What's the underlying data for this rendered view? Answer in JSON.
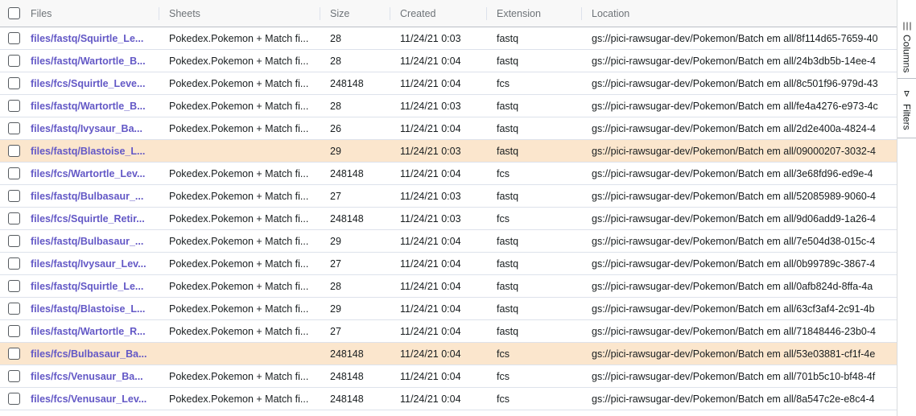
{
  "columns": {
    "files": "Files",
    "sheets": "Sheets",
    "size": "Size",
    "created": "Created",
    "extension": "Extension",
    "location": "Location"
  },
  "side_panel": {
    "columns_label": "Columns",
    "filters_label": "Filters",
    "filter_icon": "⊳"
  },
  "highlight_color": "#fbe6cd",
  "link_color": "#6358c6",
  "rows": [
    {
      "files": "files/fastq/Squirtle_Le...",
      "sheets": "Pokedex.Pokemon + Match fi...",
      "size": "28",
      "created": "11/24/21 0:03",
      "ext": "fastq",
      "loc": "gs://pici-rawsugar-dev/Pokemon/Batch em all/8f114d65-7659-40",
      "highlight": false
    },
    {
      "files": "files/fastq/Wartortle_B...",
      "sheets": "Pokedex.Pokemon + Match fi...",
      "size": "28",
      "created": "11/24/21 0:04",
      "ext": "fastq",
      "loc": "gs://pici-rawsugar-dev/Pokemon/Batch em all/24b3db5b-14ee-4",
      "highlight": false
    },
    {
      "files": "files/fcs/Squirtle_Leve...",
      "sheets": "Pokedex.Pokemon + Match fi...",
      "size": "248148",
      "created": "11/24/21 0:04",
      "ext": "fcs",
      "loc": "gs://pici-rawsugar-dev/Pokemon/Batch em all/8c501f96-979d-43",
      "highlight": false
    },
    {
      "files": "files/fastq/Wartortle_B...",
      "sheets": "Pokedex.Pokemon + Match fi...",
      "size": "28",
      "created": "11/24/21 0:03",
      "ext": "fastq",
      "loc": "gs://pici-rawsugar-dev/Pokemon/Batch em all/fe4a4276-e973-4c",
      "highlight": false
    },
    {
      "files": "files/fastq/Ivysaur_Ba...",
      "sheets": "Pokedex.Pokemon + Match fi...",
      "size": "26",
      "created": "11/24/21 0:04",
      "ext": "fastq",
      "loc": "gs://pici-rawsugar-dev/Pokemon/Batch em all/2d2e400a-4824-4",
      "highlight": false
    },
    {
      "files": "files/fastq/Blastoise_L...",
      "sheets": "",
      "size": "29",
      "created": "11/24/21 0:03",
      "ext": "fastq",
      "loc": "gs://pici-rawsugar-dev/Pokemon/Batch em all/09000207-3032-4",
      "highlight": true
    },
    {
      "files": "files/fcs/Wartortle_Lev...",
      "sheets": "Pokedex.Pokemon + Match fi...",
      "size": "248148",
      "created": "11/24/21 0:04",
      "ext": "fcs",
      "loc": "gs://pici-rawsugar-dev/Pokemon/Batch em all/3e68fd96-ed9e-4",
      "highlight": false
    },
    {
      "files": "files/fastq/Bulbasaur_...",
      "sheets": "Pokedex.Pokemon + Match fi...",
      "size": "27",
      "created": "11/24/21 0:03",
      "ext": "fastq",
      "loc": "gs://pici-rawsugar-dev/Pokemon/Batch em all/52085989-9060-4",
      "highlight": false
    },
    {
      "files": "files/fcs/Squirtle_Retir...",
      "sheets": "Pokedex.Pokemon + Match fi...",
      "size": "248148",
      "created": "11/24/21 0:03",
      "ext": "fcs",
      "loc": "gs://pici-rawsugar-dev/Pokemon/Batch em all/9d06add9-1a26-4",
      "highlight": false
    },
    {
      "files": "files/fastq/Bulbasaur_...",
      "sheets": "Pokedex.Pokemon + Match fi...",
      "size": "29",
      "created": "11/24/21 0:04",
      "ext": "fastq",
      "loc": "gs://pici-rawsugar-dev/Pokemon/Batch em all/7e504d38-015c-4",
      "highlight": false
    },
    {
      "files": "files/fastq/Ivysaur_Lev...",
      "sheets": "Pokedex.Pokemon + Match fi...",
      "size": "27",
      "created": "11/24/21 0:04",
      "ext": "fastq",
      "loc": "gs://pici-rawsugar-dev/Pokemon/Batch em all/0b99789c-3867-4",
      "highlight": false
    },
    {
      "files": "files/fastq/Squirtle_Le...",
      "sheets": "Pokedex.Pokemon + Match fi...",
      "size": "28",
      "created": "11/24/21 0:04",
      "ext": "fastq",
      "loc": "gs://pici-rawsugar-dev/Pokemon/Batch em all/0afb824d-8ffa-4a",
      "highlight": false
    },
    {
      "files": "files/fastq/Blastoise_L...",
      "sheets": "Pokedex.Pokemon + Match fi...",
      "size": "29",
      "created": "11/24/21 0:04",
      "ext": "fastq",
      "loc": "gs://pici-rawsugar-dev/Pokemon/Batch em all/63cf3af4-2c91-4b",
      "highlight": false
    },
    {
      "files": "files/fastq/Wartortle_R...",
      "sheets": "Pokedex.Pokemon + Match fi...",
      "size": "27",
      "created": "11/24/21 0:04",
      "ext": "fastq",
      "loc": "gs://pici-rawsugar-dev/Pokemon/Batch em all/71848446-23b0-4",
      "highlight": false
    },
    {
      "files": "files/fcs/Bulbasaur_Ba...",
      "sheets": "",
      "size": "248148",
      "created": "11/24/21 0:04",
      "ext": "fcs",
      "loc": "gs://pici-rawsugar-dev/Pokemon/Batch em all/53e03881-cf1f-4e",
      "highlight": true
    },
    {
      "files": "files/fcs/Venusaur_Ba...",
      "sheets": "Pokedex.Pokemon + Match fi...",
      "size": "248148",
      "created": "11/24/21 0:04",
      "ext": "fcs",
      "loc": "gs://pici-rawsugar-dev/Pokemon/Batch em all/701b5c10-bf48-4f",
      "highlight": false
    },
    {
      "files": "files/fcs/Venusaur_Lev...",
      "sheets": "Pokedex.Pokemon + Match fi...",
      "size": "248148",
      "created": "11/24/21 0:04",
      "ext": "fcs",
      "loc": "gs://pici-rawsugar-dev/Pokemon/Batch em all/8a547c2e-e8c4-4",
      "highlight": false
    }
  ]
}
